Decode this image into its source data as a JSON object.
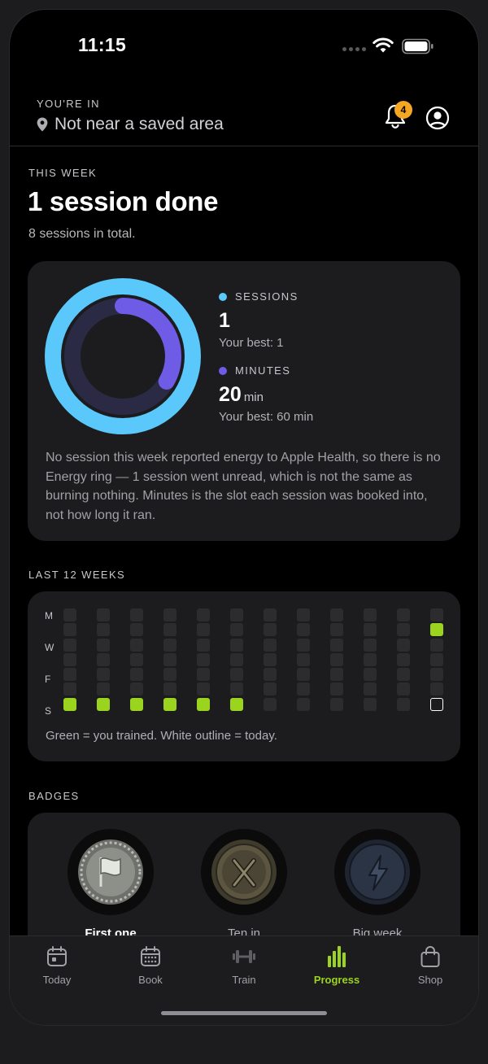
{
  "status_bar": {
    "time": "11:15",
    "wifi_icon": "wifi-icon",
    "battery_icon": "battery-icon"
  },
  "header": {
    "caption": "YOU'RE IN",
    "location": "Not near a saved area",
    "location_icon": "location-pin-icon",
    "notification_count": "4",
    "bell_icon": "bell-icon",
    "profile_icon": "profile-icon"
  },
  "this_week": {
    "caption": "THIS WEEK",
    "title": "1 session done",
    "subtitle": "8 sessions in total.",
    "rings": {
      "sessions": {
        "label": "SESSIONS",
        "value": "1",
        "best": "Your best: 1",
        "progress": 1.0,
        "color": "#5ac8fa"
      },
      "minutes": {
        "label": "MINUTES",
        "value": "20",
        "unit": "min",
        "best": "Your best: 60 min",
        "progress": 0.333,
        "color": "#6e5ce6"
      },
      "note": "No session this week reported energy to Apple Health, so there is no Energy ring — 1 session went unread, which is not the same as burning nothing. Minutes is the slot each session was booked into, not how long it ran."
    }
  },
  "last_12_weeks": {
    "caption": "LAST 12 WEEKS",
    "day_labels": [
      "M",
      "W",
      "F",
      "S"
    ],
    "weeks": [
      {
        "trained_days": [
          7
        ],
        "today_day": null
      },
      {
        "trained_days": [
          7
        ],
        "today_day": null
      },
      {
        "trained_days": [
          7
        ],
        "today_day": null
      },
      {
        "trained_days": [
          7
        ],
        "today_day": null
      },
      {
        "trained_days": [
          7
        ],
        "today_day": null
      },
      {
        "trained_days": [
          7
        ],
        "today_day": null
      },
      {
        "trained_days": [],
        "today_day": null
      },
      {
        "trained_days": [],
        "today_day": null
      },
      {
        "trained_days": [],
        "today_day": null
      },
      {
        "trained_days": [],
        "today_day": null
      },
      {
        "trained_days": [],
        "today_day": null
      },
      {
        "trained_days": [
          2
        ],
        "today_day": 7
      }
    ],
    "trained_color": "#9bd41f",
    "note": "Green = you trained. White outline = today."
  },
  "badges": {
    "caption": "BADGES",
    "items": [
      {
        "name": "First one",
        "icon": "flag-medal-icon",
        "unlocked": true
      },
      {
        "name": "Ten in",
        "icon": "x-medal-icon",
        "unlocked": false
      },
      {
        "name": "Big week",
        "icon": "lightning-medal-icon",
        "unlocked": false
      }
    ]
  },
  "tab_bar": {
    "tabs": [
      {
        "label": "Today",
        "icon": "calendar-icon",
        "active": false
      },
      {
        "label": "Book",
        "icon": "calendar-grid-icon",
        "active": false
      },
      {
        "label": "Train",
        "icon": "dumbbell-icon",
        "active": false
      },
      {
        "label": "Progress",
        "icon": "bar-chart-icon",
        "active": true
      },
      {
        "label": "Shop",
        "icon": "shopping-bag-icon",
        "active": false
      }
    ],
    "accent_color": "#9bd41f"
  }
}
